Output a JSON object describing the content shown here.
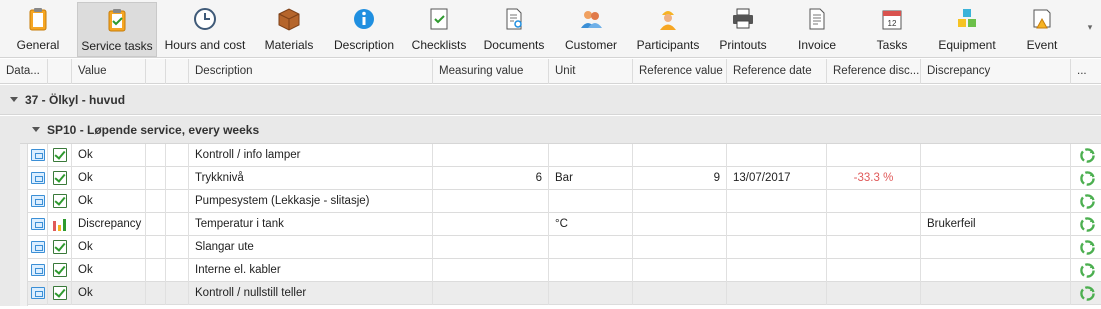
{
  "ribbon": {
    "buttons": [
      {
        "label": "General",
        "icon": "clipboard-icon",
        "active": false
      },
      {
        "label": "Service tasks",
        "icon": "clipboard-check-icon",
        "active": true
      },
      {
        "label": "Hours and cost",
        "icon": "clock-icon",
        "active": false
      },
      {
        "label": "Materials",
        "icon": "box-icon",
        "active": false
      },
      {
        "label": "Description",
        "icon": "info-icon",
        "active": false
      },
      {
        "label": "Checklists",
        "icon": "checklist-icon",
        "active": false
      },
      {
        "label": "Documents",
        "icon": "document-icon",
        "active": false
      },
      {
        "label": "Customer",
        "icon": "customer-icon",
        "active": false
      },
      {
        "label": "Participants",
        "icon": "participant-icon",
        "active": false
      },
      {
        "label": "Printouts",
        "icon": "printer-icon",
        "active": false
      },
      {
        "label": "Invoice",
        "icon": "invoice-icon",
        "active": false
      },
      {
        "label": "Tasks",
        "icon": "calendar-icon",
        "active": false
      },
      {
        "label": "Equipment",
        "icon": "cubes-icon",
        "active": false
      },
      {
        "label": "Event",
        "icon": "event-icon",
        "active": false
      }
    ]
  },
  "grid": {
    "columns": [
      "Data...",
      "",
      "Value",
      "",
      "",
      "Description",
      "Measuring value",
      "Unit",
      "Reference value",
      "Reference date",
      "Reference disc...",
      "Discrepancy",
      "..."
    ],
    "group1": "37 - Ölkyl - huvud",
    "group2": "SP10 - Løpende service, every  weeks",
    "rows": [
      {
        "status": "ok",
        "value": "Ok",
        "description": "Kontroll / info lamper",
        "measuring": "",
        "unit": "",
        "ref_value": "",
        "ref_date": "",
        "ref_disc": "",
        "discrepancy": ""
      },
      {
        "status": "ok",
        "value": "Ok",
        "description": "Trykknivå",
        "measuring": "6",
        "unit": "Bar",
        "ref_value": "9",
        "ref_date": "13/07/2017",
        "ref_disc": "-33.3 %",
        "discrepancy": ""
      },
      {
        "status": "ok",
        "value": "Ok",
        "description": "Pumpesystem (Lekkasje - slitasje)",
        "measuring": "",
        "unit": "",
        "ref_value": "",
        "ref_date": "",
        "ref_disc": "",
        "discrepancy": ""
      },
      {
        "status": "discrepancy",
        "value": "Discrepancy",
        "description": "Temperatur i tank",
        "measuring": "",
        "unit": "°C",
        "ref_value": "",
        "ref_date": "",
        "ref_disc": "",
        "discrepancy": "Brukerfeil"
      },
      {
        "status": "ok",
        "value": "Ok",
        "description": "Slangar ute",
        "measuring": "",
        "unit": "",
        "ref_value": "",
        "ref_date": "",
        "ref_disc": "",
        "discrepancy": ""
      },
      {
        "status": "ok",
        "value": "Ok",
        "description": "Interne el. kabler",
        "measuring": "",
        "unit": "",
        "ref_value": "",
        "ref_date": "",
        "ref_disc": "",
        "discrepancy": ""
      },
      {
        "status": "ok",
        "value": "Ok",
        "description": "Kontroll / nullstill teller",
        "measuring": "",
        "unit": "",
        "ref_value": "",
        "ref_date": "",
        "ref_disc": "",
        "discrepancy": ""
      }
    ]
  },
  "colors": {
    "negative": "#e05a5a",
    "check": "#2e9a2e",
    "ok_icon": "#3b8fd6",
    "recycle": "#4caf50"
  }
}
